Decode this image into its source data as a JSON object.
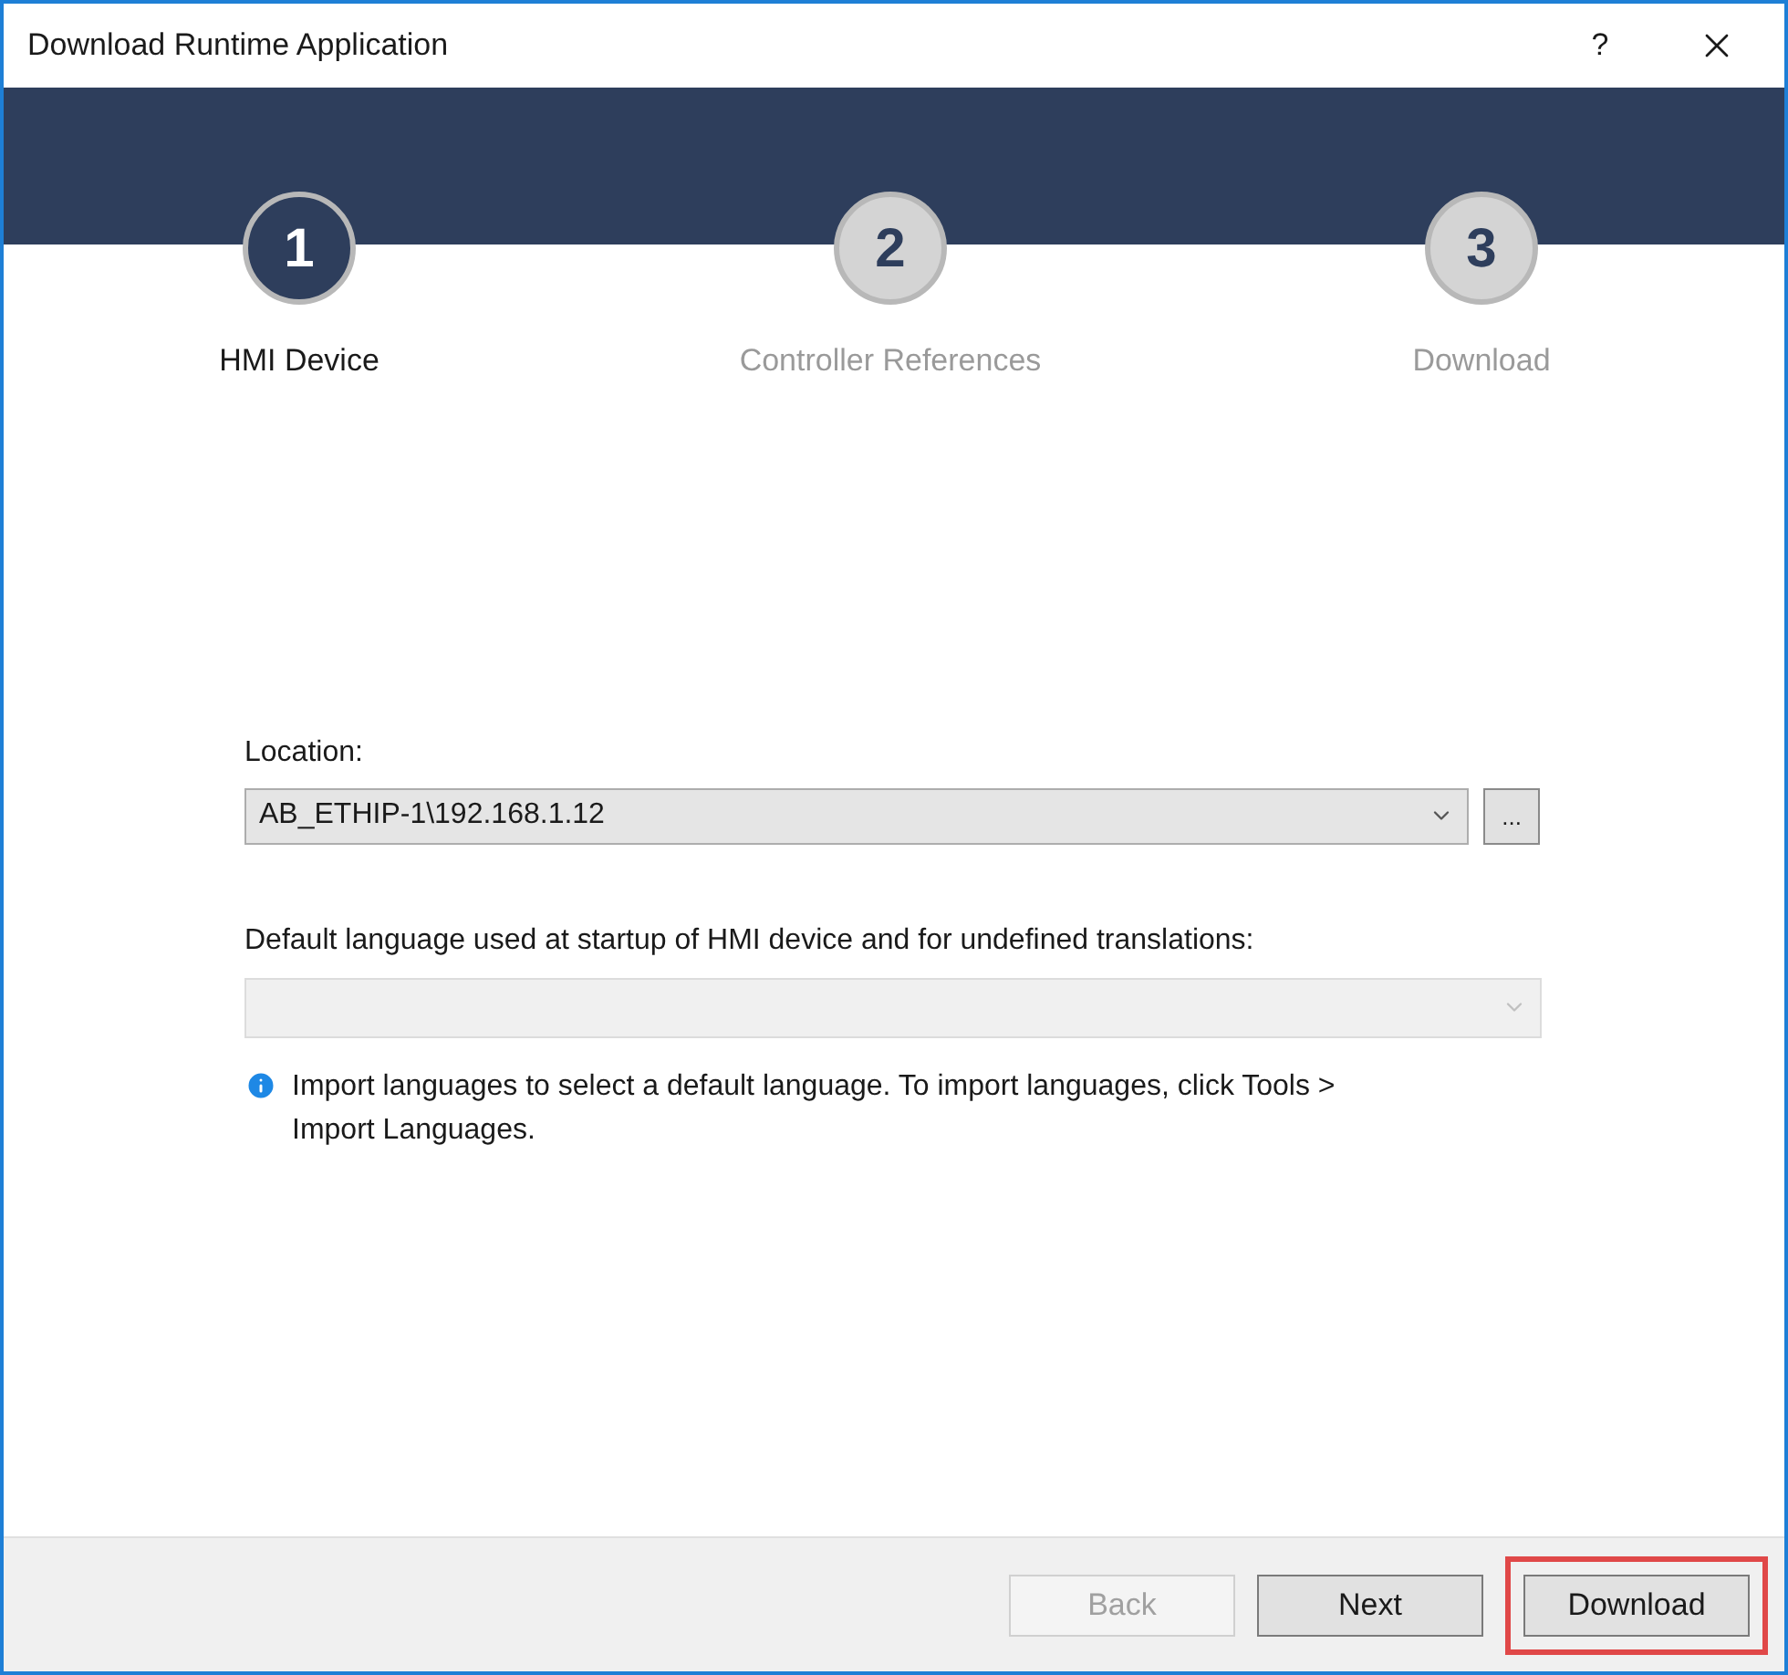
{
  "window": {
    "title": "Download Runtime Application",
    "help": "?"
  },
  "steps": [
    {
      "number": "1",
      "label": "HMI Device",
      "selected": true
    },
    {
      "number": "2",
      "label": "Controller References",
      "selected": false
    },
    {
      "number": "3",
      "label": "Download",
      "selected": false
    }
  ],
  "location": {
    "label": "Location:",
    "value": "AB_ETHIP-1\\192.168.1.12",
    "browse": "..."
  },
  "language": {
    "label": "Default language used at startup of HMI device and for undefined translations:",
    "disabled": true
  },
  "info": "Import languages to select a default language.  To import languages, click Tools > Import Languages.",
  "buttons": [
    {
      "label": "Back",
      "disabled": true,
      "highlighted": false
    },
    {
      "label": "Next",
      "disabled": false,
      "highlighted": false
    },
    {
      "label": "Download",
      "disabled": false,
      "highlighted": true
    }
  ]
}
